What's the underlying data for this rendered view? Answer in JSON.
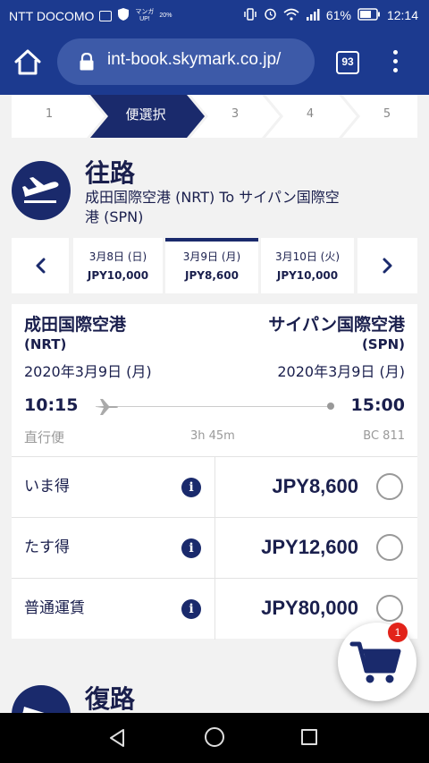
{
  "status_bar": {
    "carrier": "NTT DOCOMO",
    "battery": "61%",
    "time": "12:14",
    "mini_label": "マンガ\nUP!",
    "mini_pct": "20%"
  },
  "browser": {
    "url": "int-book.skymark.co.jp/",
    "tab_count": "93"
  },
  "steps": [
    "1",
    "便選択",
    "3",
    "4",
    "5"
  ],
  "outbound": {
    "title": "往路",
    "route_line1": "成田国際空港 (NRT) To サイパン国際空",
    "route_line2": "港 (SPN)"
  },
  "dates": [
    {
      "date": "3月8日 (日)",
      "price": "JPY10,000"
    },
    {
      "date": "3月9日 (月)",
      "price": "JPY8,600"
    },
    {
      "date": "3月10日 (火)",
      "price": "JPY10,000"
    }
  ],
  "flight": {
    "dep_airport": "成田国際空港",
    "dep_code": "(NRT)",
    "arr_airport": "サイパン国際空港",
    "arr_code": "(SPN)",
    "dep_date": "2020年3月9日 (月)",
    "arr_date": "2020年3月9日 (月)",
    "dep_time": "10:15",
    "arr_time": "15:00",
    "type": "直行便",
    "duration": "3h 45m",
    "flight_no": "BC 811"
  },
  "fares": [
    {
      "name": "いま得",
      "price": "JPY8,600"
    },
    {
      "name": "たす得",
      "price": "JPY12,600"
    },
    {
      "name": "普通運賃",
      "price": "JPY80,000"
    }
  ],
  "return": {
    "title": "復路"
  },
  "cart": {
    "badge": "1"
  },
  "colors": {
    "brand_navy": "#1a2a6c",
    "browser_blue": "#1c3a8f",
    "badge_red": "#e2231a"
  }
}
